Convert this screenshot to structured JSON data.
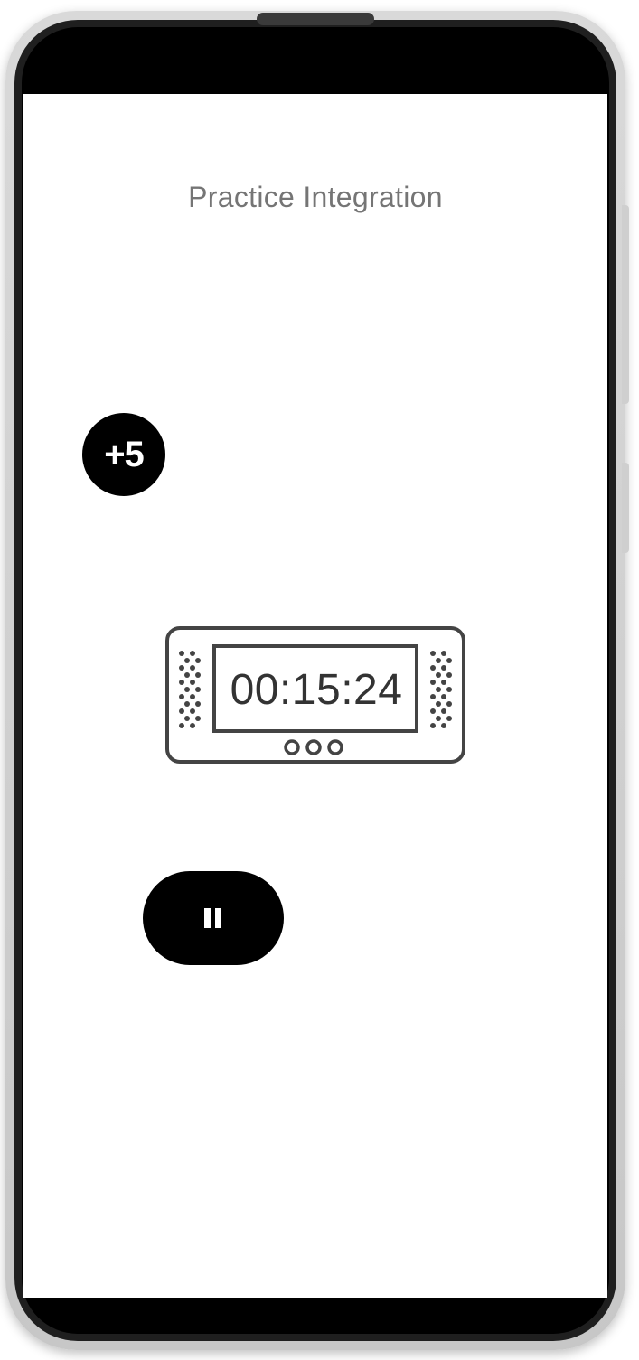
{
  "screen": {
    "title": "Practice Integration",
    "bonus_button": {
      "label": "+5"
    },
    "timer": {
      "display": "00:15:24"
    },
    "pause_button": {
      "icon": "pause-icon"
    }
  },
  "colors": {
    "title_text": "#757575",
    "button_bg": "#000000",
    "button_fg": "#ffffff",
    "timer_stroke": "#444444"
  }
}
